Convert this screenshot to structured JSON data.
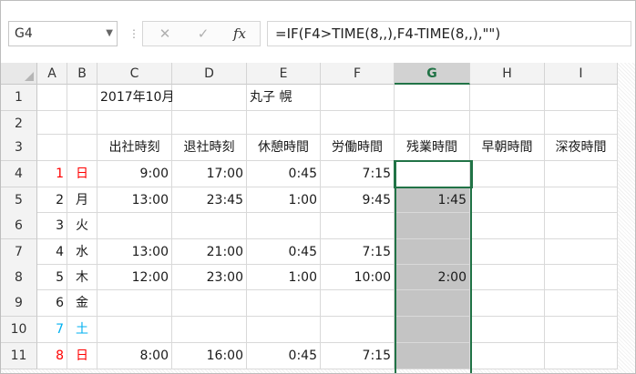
{
  "name_box": "G4",
  "formula": "=IF(F4>TIME(8,,),F4-TIME(8,,),\"\")",
  "formula_buttons": {
    "cancel": "✕",
    "enter": "✓",
    "fx": "fx"
  },
  "column_headers": [
    "A",
    "B",
    "C",
    "D",
    "E",
    "F",
    "G",
    "H",
    "I"
  ],
  "selected_column": "G",
  "row_headers": [
    "1",
    "2",
    "3",
    "4",
    "5",
    "6",
    "7",
    "8",
    "9",
    "10",
    "11"
  ],
  "sheet": {
    "year_month": "2017年10月",
    "name": "丸子 幌",
    "headers": [
      "出社時刻",
      "退社時刻",
      "休憩時間",
      "労働時間",
      "残業時間",
      "早朝時間",
      "深夜時間"
    ],
    "rows": [
      {
        "row": "4",
        "day": "1",
        "dow": "日",
        "dow_color": "red",
        "start": "9:00",
        "end": "17:00",
        "break": "0:45",
        "work": "7:15",
        "overtime": "",
        "shaded": false
      },
      {
        "row": "5",
        "day": "2",
        "dow": "月",
        "dow_color": "",
        "start": "13:00",
        "end": "23:45",
        "break": "1:00",
        "work": "9:45",
        "overtime": "1:45",
        "shaded": true
      },
      {
        "row": "6",
        "day": "3",
        "dow": "火",
        "dow_color": "",
        "start": "",
        "end": "",
        "break": "",
        "work": "",
        "overtime": "",
        "shaded": true
      },
      {
        "row": "7",
        "day": "4",
        "dow": "水",
        "dow_color": "",
        "start": "13:00",
        "end": "21:00",
        "break": "0:45",
        "work": "7:15",
        "overtime": "",
        "shaded": true
      },
      {
        "row": "8",
        "day": "5",
        "dow": "木",
        "dow_color": "",
        "start": "12:00",
        "end": "23:00",
        "break": "1:00",
        "work": "10:00",
        "overtime": "2:00",
        "shaded": true
      },
      {
        "row": "9",
        "day": "6",
        "dow": "金",
        "dow_color": "",
        "start": "",
        "end": "",
        "break": "",
        "work": "",
        "overtime": "",
        "shaded": true
      },
      {
        "row": "10",
        "day": "7",
        "dow": "土",
        "dow_color": "blue",
        "start": "",
        "end": "",
        "break": "",
        "work": "",
        "overtime": "",
        "shaded": true
      },
      {
        "row": "11",
        "day": "8",
        "dow": "日",
        "dow_color": "red",
        "start": "8:00",
        "end": "16:00",
        "break": "0:45",
        "work": "7:15",
        "overtime": "",
        "shaded": true
      }
    ]
  },
  "colors": {
    "selection": "#217346",
    "shade": "#c4c4c4",
    "sunday": "#ff0000",
    "saturday": "#00b0f0"
  }
}
